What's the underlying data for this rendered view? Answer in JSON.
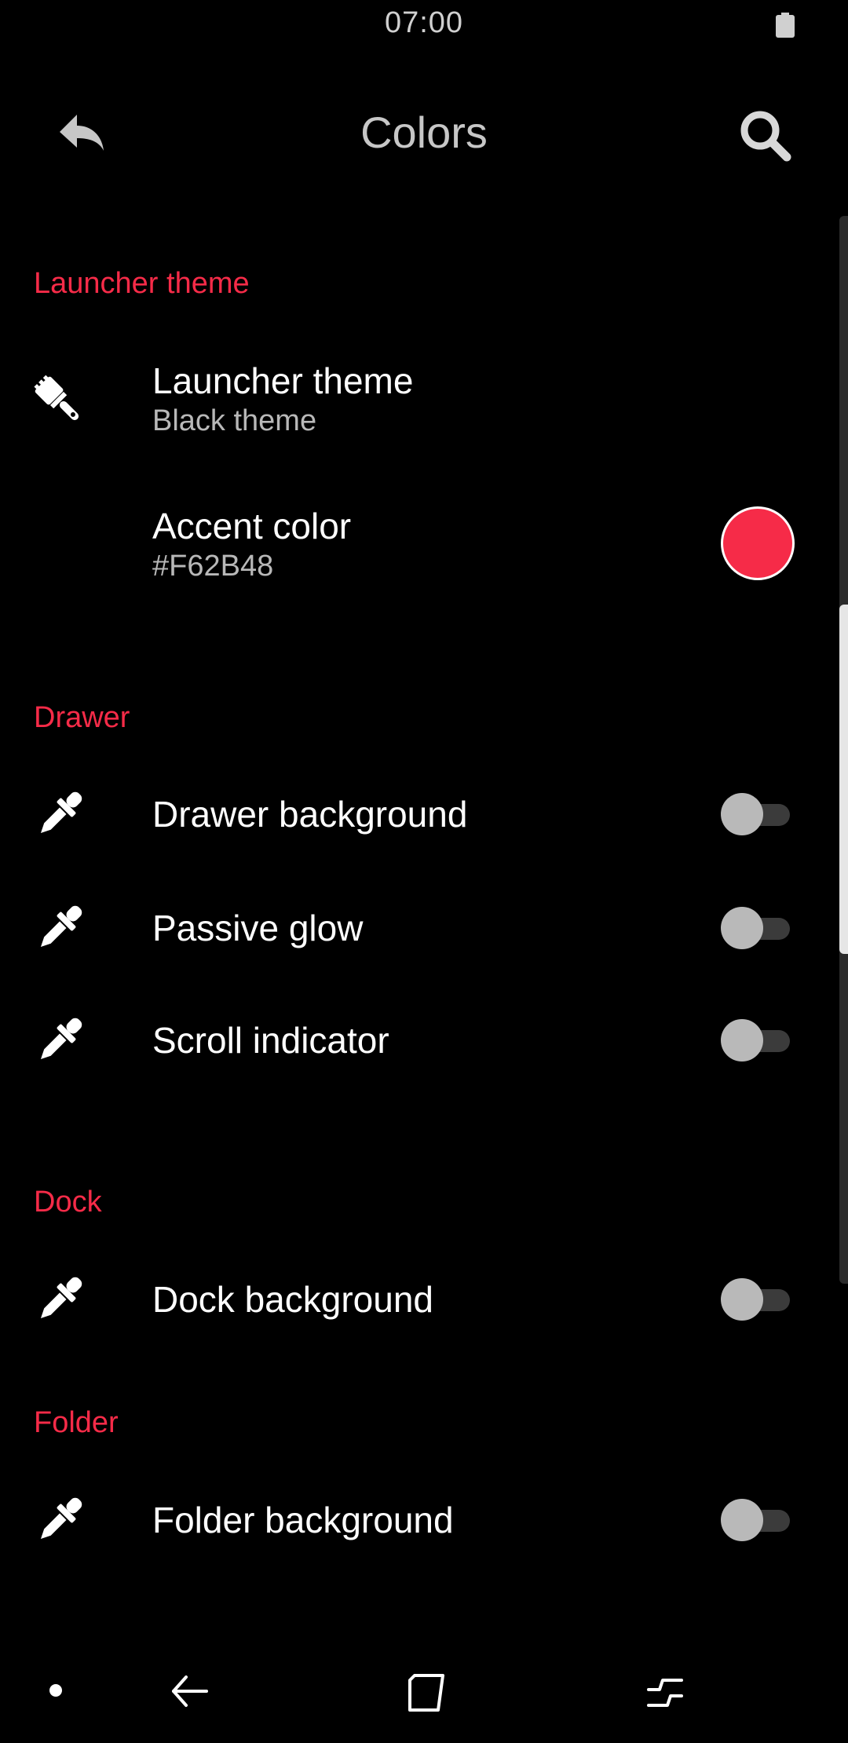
{
  "status_bar": {
    "time": "07:00",
    "battery_icon": "battery-icon"
  },
  "app_bar": {
    "title": "Colors",
    "back_icon": "reply-arrow-icon",
    "search_icon": "search-icon"
  },
  "sections": {
    "launcher": {
      "header": "Launcher theme",
      "theme_row": {
        "title": "Launcher theme",
        "subtitle": "Black theme",
        "icon": "paintbrush-icon"
      },
      "accent_row": {
        "title": "Accent color",
        "subtitle": "#F62B48",
        "swatch_color": "#F62B48"
      }
    },
    "drawer": {
      "header": "Drawer",
      "items": [
        {
          "title": "Drawer background",
          "icon": "eyedropper-icon",
          "enabled": false
        },
        {
          "title": "Passive glow",
          "icon": "eyedropper-icon",
          "enabled": false
        },
        {
          "title": "Scroll indicator",
          "icon": "eyedropper-icon",
          "enabled": false
        }
      ]
    },
    "dock": {
      "header": "Dock",
      "items": [
        {
          "title": "Dock background",
          "icon": "eyedropper-icon",
          "enabled": false
        }
      ]
    },
    "folder": {
      "header": "Folder",
      "items": [
        {
          "title": "Folder background",
          "icon": "eyedropper-icon",
          "enabled": false
        }
      ]
    }
  },
  "colors": {
    "accent": "#F62B48",
    "background": "#000000",
    "title": "#C7C7C7",
    "subtitle": "#B8B8B8"
  },
  "nav_bar": {
    "icons": [
      "dot-icon",
      "back-arrow-icon",
      "home-square-icon",
      "recents-icon"
    ]
  }
}
